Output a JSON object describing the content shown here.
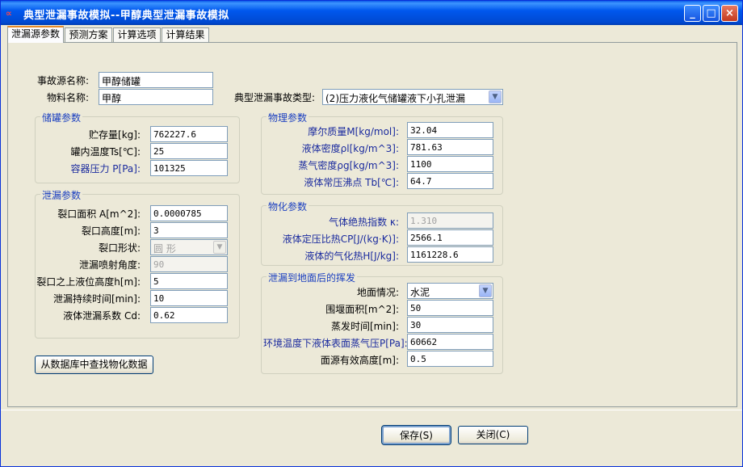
{
  "window": {
    "title": "典型泄漏事故模拟--甲醇典型泄漏事故模拟",
    "app_icon": "∝",
    "minimize_glyph": "_",
    "maximize_glyph": "□",
    "close_glyph": "×"
  },
  "tabs": [
    "泄漏源参数",
    "预测方案",
    "计算选项",
    "计算结果"
  ],
  "top": {
    "accident_name_label": "事故源名称:",
    "accident_name_value": "甲醇储罐",
    "material_label": "物料名称:",
    "material_value": "甲醇",
    "accident_type_label": "典型泄漏事故类型:",
    "accident_type_value": "(2)压力液化气储罐液下小孔泄漏"
  },
  "storage": {
    "title": "储罐参数",
    "rows": [
      {
        "label": "贮存量[kg]:",
        "value": "762227.6"
      },
      {
        "label": "罐内温度Ts[℃]:",
        "value": "25"
      },
      {
        "label": "容器压力 P[Pa]:",
        "value": "101325"
      }
    ]
  },
  "leak": {
    "title": "泄漏参数",
    "area_label": "裂口面积 A[m^2]:",
    "area_value": "0.0000785",
    "height_label": "裂口高度[m]:",
    "height_value": "3",
    "shape_label": "裂口形状:",
    "shape_value": "圆  形",
    "angle_label": "泄漏喷射角度:",
    "angle_value": "90",
    "liquid_height_label": "裂口之上液位高度h[m]:",
    "liquid_height_value": "5",
    "duration_label": "泄漏持续时间[min]:",
    "duration_value": "10",
    "cd_label": "液体泄漏系数  Cd:",
    "cd_value": "0.62"
  },
  "physical": {
    "title": "物理参数",
    "rows": [
      {
        "label": "摩尔质量M[kg/mol]:",
        "value": "32.04"
      },
      {
        "label": "液体密度ρl[kg/m^3]:",
        "value": "781.63"
      },
      {
        "label": "蒸气密度ρg[kg/m^3]:",
        "value": "1100"
      },
      {
        "label": "液体常压沸点 Tb[℃]:",
        "value": "64.7"
      }
    ]
  },
  "chemical": {
    "title": "物化参数",
    "rows": [
      {
        "label": "气体绝热指数 κ:",
        "value": "1.310"
      },
      {
        "label": "液体定压比热CP[J/(kg·K)]:",
        "value": "2566.1"
      },
      {
        "label": "液体的气化热H[J/kg]:",
        "value": "1161228.6"
      }
    ]
  },
  "evaporation": {
    "title": "泄漏到地面后的挥发",
    "ground_label": "地面情况:",
    "ground_value": "水泥",
    "rows": [
      {
        "label": "围堰面积[m^2]:",
        "value": "50"
      },
      {
        "label": "蒸发时间[min]:",
        "value": "30"
      },
      {
        "label": "环境温度下液体表面蒸气压P[Pa]:",
        "value": "60662"
      },
      {
        "label": "面源有效高度[m]:",
        "value": "0.5"
      }
    ]
  },
  "buttons": {
    "lookup": "从数据库中查找物化数据",
    "save": "保存(S)",
    "close": "关闭(C)"
  }
}
